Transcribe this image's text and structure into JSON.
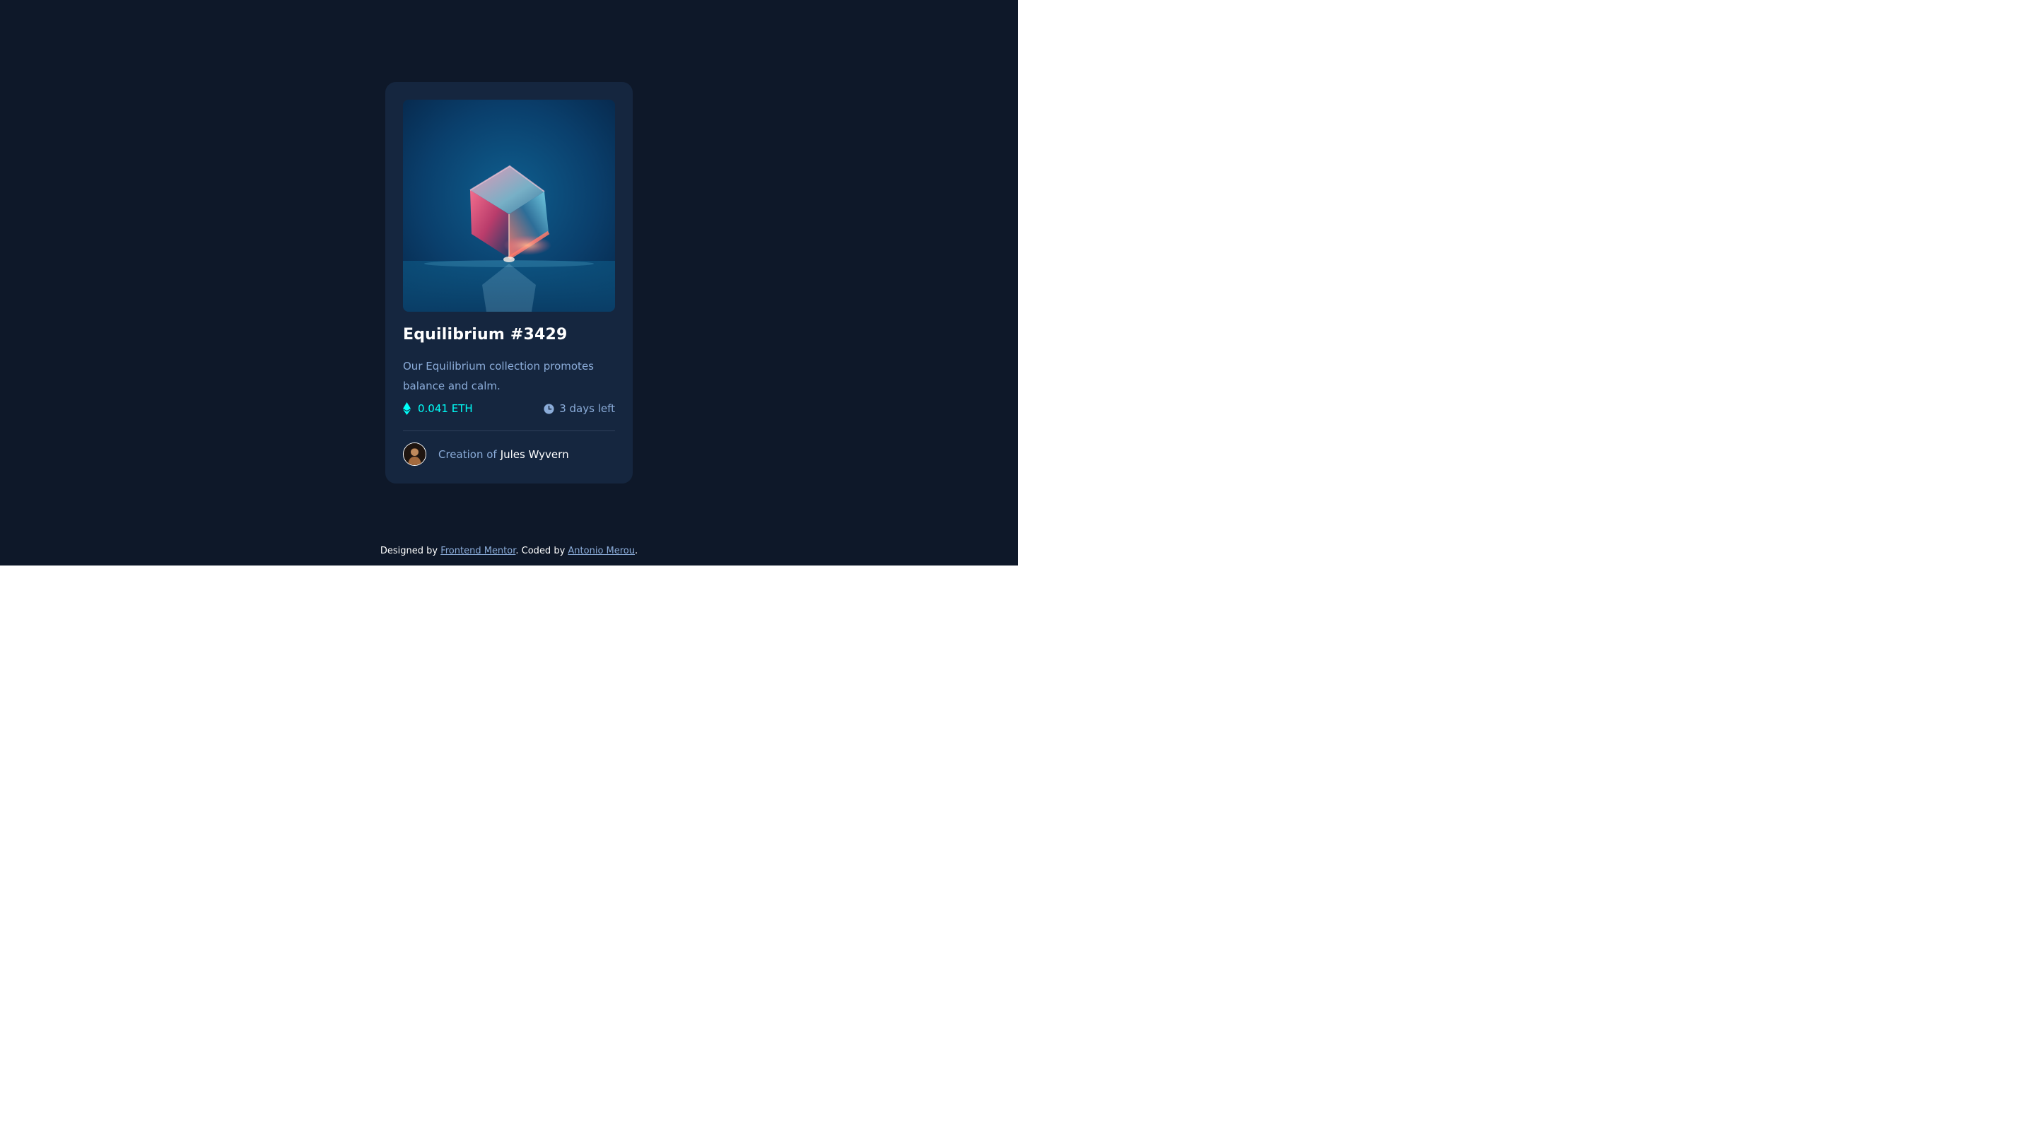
{
  "card": {
    "title": "Equilibrium #3429",
    "description": "Our Equilibrium collection promotes balance and calm.",
    "price": "0.041 ETH",
    "time_left": "3 days left",
    "creator_prefix": "Creation of",
    "creator_name": "Jules Wyvern",
    "image_icon": "crystal-cube-image",
    "price_icon": "ethereum-icon",
    "time_icon": "clock-icon"
  },
  "attribution": {
    "designed_by": "Designed by",
    "designer_link": "Frontend Mentor",
    "separator": ". Coded by",
    "coder_link": "Antonio Merou",
    "end": "."
  },
  "colors": {
    "page_background": "#0e1829",
    "card_background": "#15263f",
    "accent_cyan": "#00fff8",
    "soft_blue": "#8bacd9",
    "divider": "#2e405a",
    "white": "#ffffff"
  }
}
